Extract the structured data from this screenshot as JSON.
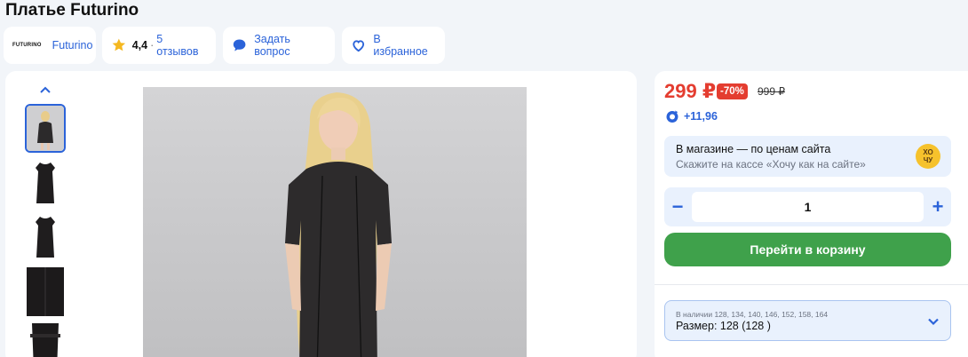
{
  "product": {
    "title": "Платье Futurino"
  },
  "chips": {
    "brand_logo": "FUTURINO",
    "brand_name": "Futurino",
    "rating": "4,4",
    "rating_sep": "·",
    "reviews": "5 отзывов",
    "ask_question": "Задать вопрос",
    "favorite": "В избранное"
  },
  "gallery": {
    "thumbnail_count": 5,
    "selected_thumbnail": 1
  },
  "buybox": {
    "price_now": "299 ₽",
    "discount": "-70%",
    "price_old": "999 ₽",
    "bonus": "+11,96",
    "store_title": "В магазине — по ценам сайта",
    "store_subtitle": "Скажите на кассе «Хочу как на сайте»",
    "hochu_logo": "ХОЧУ",
    "qty_minus": "−",
    "qty_value": "1",
    "qty_plus": "+",
    "cart_button": "Перейти в корзину",
    "size_availability": "В наличии 128, 134, 140, 146, 152, 158, 164",
    "size_selected": "Размер: 128 (128 )"
  },
  "colors": {
    "accent": "#2b63d9",
    "price": "#e43d30",
    "cart": "#3fa14b"
  }
}
